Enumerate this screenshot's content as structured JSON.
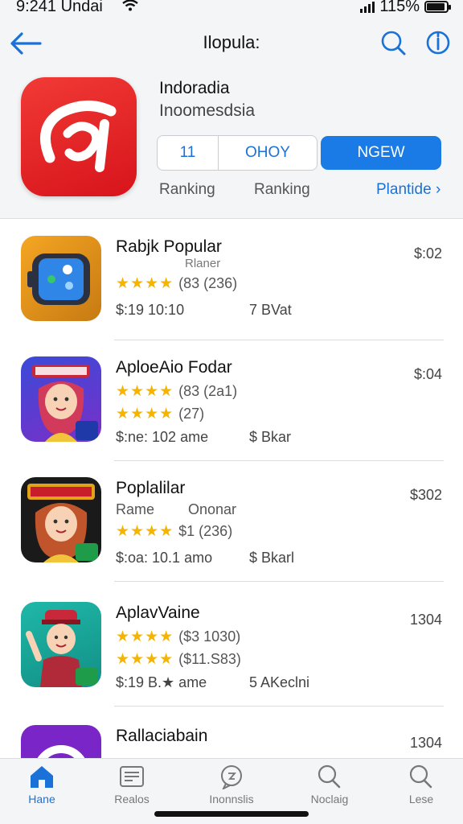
{
  "status": {
    "time": "9:241 Undai",
    "battery": "115%"
  },
  "header": {
    "title": "Ilopula:",
    "app_name": "Indoradia",
    "app_subtitle": "Inoomesdsia",
    "segment": [
      "11",
      "OHOY"
    ],
    "new_button": "NGEW",
    "ranking_1": "Ranking",
    "ranking_2": "Ranking",
    "link": "Plantide ›"
  },
  "list": [
    {
      "title": "Rabjk Popular",
      "sub": "Rlaner",
      "rating": "(83 (236)",
      "meta_left": "$:19 10:10",
      "meta_right": "7 BVat",
      "price": "$:02"
    },
    {
      "title": "AploeAio Fodar",
      "rating_1": "(83 (2a1)",
      "rating_2": "(27)",
      "meta_left": "$:ne: 102 ame",
      "meta_right": "$ Bkar",
      "price": "$:04"
    },
    {
      "title": "Poplalilar",
      "sub_left": "Rame",
      "sub_right": "Ononar",
      "rating": "$1 (236)",
      "meta_left": "$:oa: 10.1 amo",
      "meta_right": "$ Bkarl",
      "price": "$302"
    },
    {
      "title": "AplavVaine",
      "rating_1": "($3 1030)",
      "rating_2": "($11.S83)",
      "meta_left": "$:19 B.★ ame",
      "meta_right": "5 AKeclni",
      "price": "1304"
    },
    {
      "title": "Rallaciabain",
      "price": "1304"
    }
  ],
  "stars": "★★★★",
  "tabs": [
    {
      "label": "Hane",
      "icon": "home-icon"
    },
    {
      "label": "Realos",
      "icon": "news-icon"
    },
    {
      "label": "Inonnslis",
      "icon": "chat-icon"
    },
    {
      "label": "Noclaig",
      "icon": "search-icon"
    },
    {
      "label": "Lese",
      "icon": "search-icon"
    }
  ],
  "colors": {
    "accent": "#1a7be6",
    "app_icon": "#e8232a",
    "star": "#f5b400"
  }
}
